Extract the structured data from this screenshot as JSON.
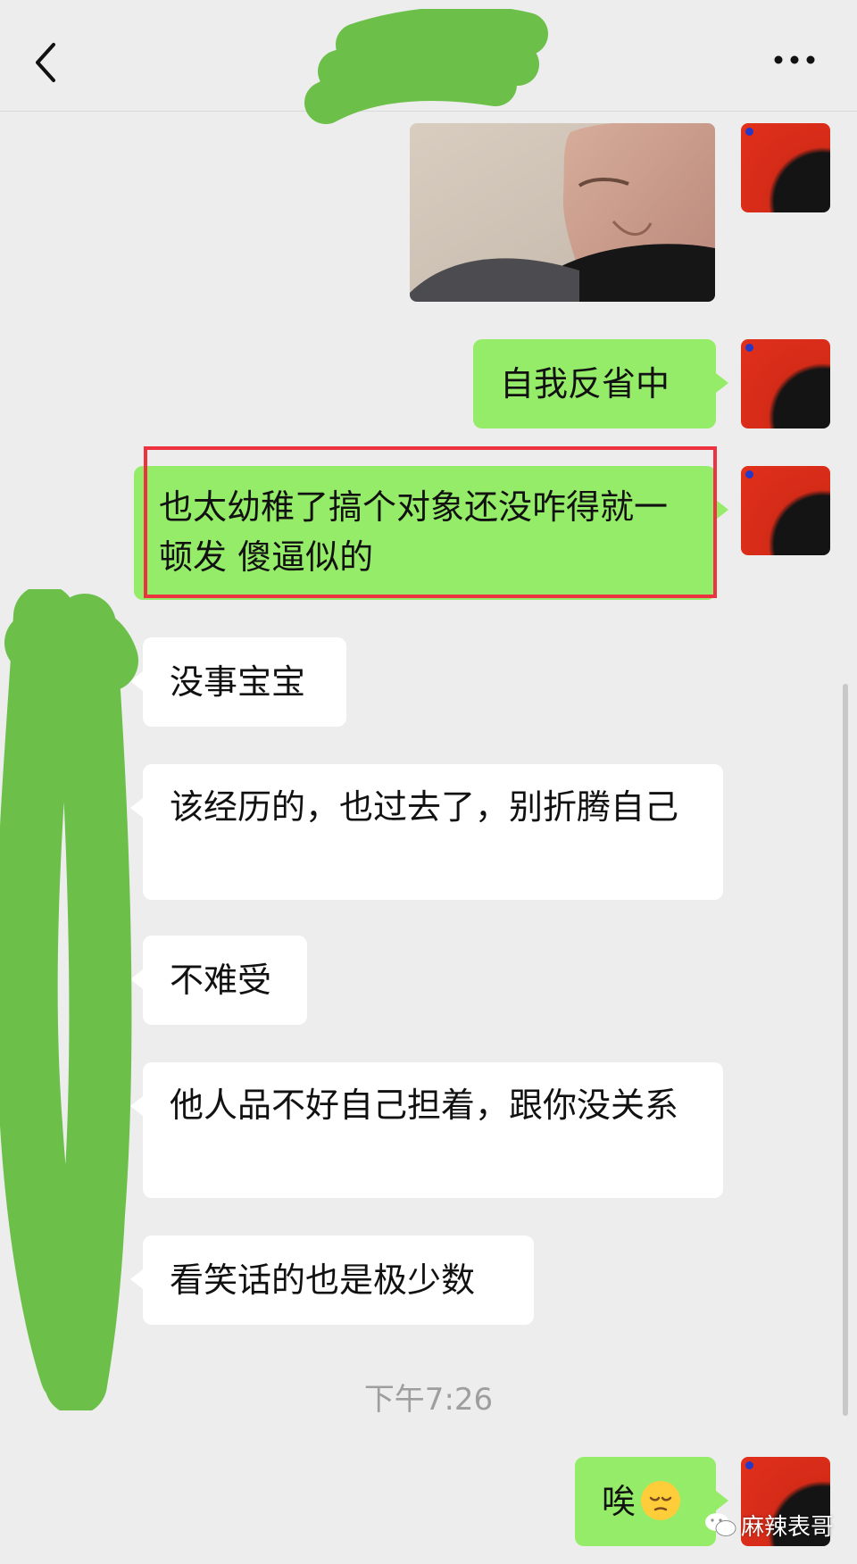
{
  "header": {
    "title": "",
    "back_icon": "chevron-left-icon",
    "more_icon": "more-horizontal-icon"
  },
  "messages": [
    {
      "side": "me",
      "type": "image",
      "description": "photo"
    },
    {
      "side": "me",
      "type": "text",
      "text": "自我反省中"
    },
    {
      "side": "me",
      "type": "text",
      "text": "也太幼稚了搞个对象还没咋得就一顿发 傻逼似的",
      "highlighted": true
    },
    {
      "side": "them",
      "type": "text",
      "text": "没事宝宝"
    },
    {
      "side": "them",
      "type": "text",
      "text": "该经历的，也过去了，别折腾自己"
    },
    {
      "side": "them",
      "type": "text",
      "text": "不难受"
    },
    {
      "side": "them",
      "type": "text",
      "text": "他人品不好自己担着，跟你没关系"
    },
    {
      "side": "them",
      "type": "text",
      "text": "看笑话的也是极少数"
    }
  ],
  "timestamp": "下午7:26",
  "last_message": {
    "side": "me",
    "text": "唉",
    "emoji": "pensive-face-icon"
  },
  "watermark": {
    "text": "麻辣表哥",
    "icon": "wechat-icon"
  },
  "colors": {
    "background": "#ededed",
    "my_bubble": "#95ec69",
    "their_bubble": "#ffffff",
    "highlight": "#ee3340",
    "redaction": "#6cc04a"
  }
}
